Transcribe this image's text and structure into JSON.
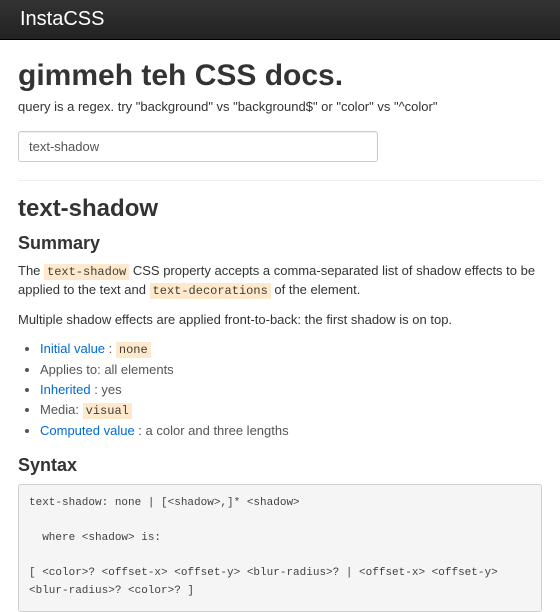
{
  "navbar": {
    "brand": "InstaCSS"
  },
  "hero": {
    "title": "gimmeh teh CSS docs.",
    "subtitle": "query is a regex. try \"background\" vs \"background$\" or \"color\" vs \"^color\""
  },
  "search": {
    "value": "text-shadow"
  },
  "doc": {
    "title": "text-shadow",
    "summary": {
      "heading": "Summary",
      "para1_pre": "The ",
      "code1": "text-shadow",
      "para1_mid": " CSS property accepts a comma-separated list of shadow effects to be applied to the text and ",
      "code2": "text-decorations",
      "para1_post": " of the element.",
      "para2": "Multiple shadow effects are applied front-to-back: the first shadow is on top.",
      "list": {
        "initial_label": "Initial value",
        "initial_sep": " : ",
        "initial_code": "none",
        "applies": "Applies to: all elements",
        "inherited_label": "Inherited",
        "inherited_rest": " : yes",
        "media_label": "Media: ",
        "media_code": "visual",
        "computed_label": "Computed value",
        "computed_rest": " : a color and three lengths"
      }
    },
    "syntax": {
      "heading": "Syntax",
      "code": "text-shadow: none | [<shadow>,]* <shadow>\n\n  where <shadow> is:\n\n[ <color>? <offset-x> <offset-y> <blur-radius>? | <offset-x> <offset-y> <blur-radius>? <color>? ]"
    }
  }
}
